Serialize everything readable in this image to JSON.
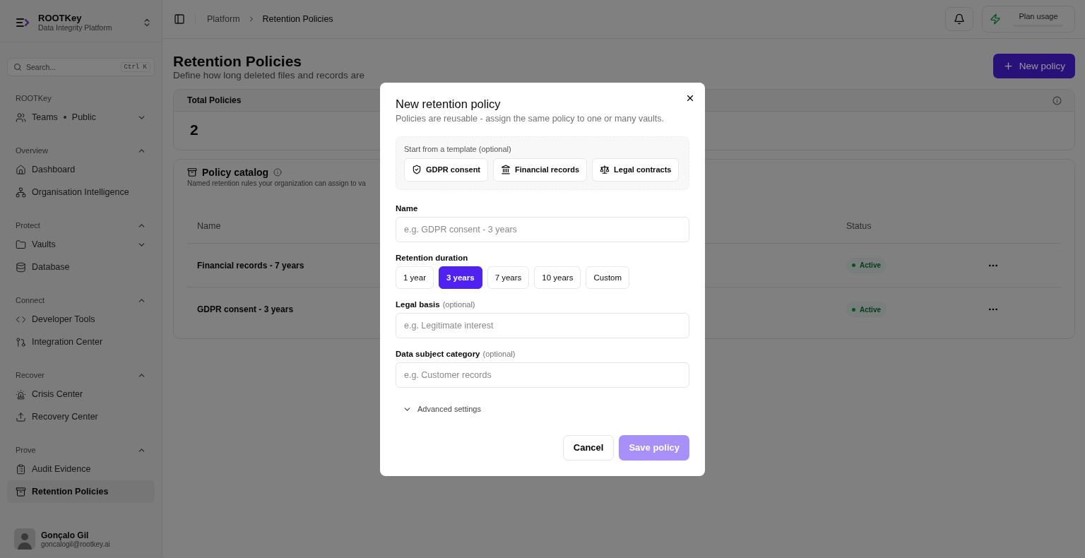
{
  "sidebar": {
    "org": {
      "name": "ROOTKey",
      "subtitle": "Data Integrity Platform"
    },
    "search": {
      "placeholder": "Search...",
      "shortcut": "Ctrl K"
    },
    "sections": [
      {
        "title": "ROOTKey",
        "items": [
          {
            "label": "Teams",
            "suffix": "Public",
            "expandable": true,
            "selected": false
          }
        ]
      },
      {
        "title": "Overview",
        "expanded": true,
        "items": [
          {
            "label": "Dashboard",
            "selected": false
          },
          {
            "label": "Organisation Intelligence",
            "selected": false
          }
        ]
      },
      {
        "title": "Protect",
        "expanded": true,
        "items": [
          {
            "label": "Vaults",
            "expandable": true,
            "selected": false
          },
          {
            "label": "Database",
            "selected": false
          }
        ]
      },
      {
        "title": "Connect",
        "expanded": true,
        "items": [
          {
            "label": "Developer Tools",
            "selected": false
          },
          {
            "label": "Integration Center",
            "selected": false
          }
        ]
      },
      {
        "title": "Recover",
        "expanded": true,
        "items": [
          {
            "label": "Crisis Center",
            "selected": false
          },
          {
            "label": "Recovery Center",
            "selected": false
          }
        ]
      },
      {
        "title": "Prove",
        "expanded": true,
        "items": [
          {
            "label": "Audit Evidence",
            "selected": false
          },
          {
            "label": "Retention Policies",
            "selected": true
          }
        ]
      }
    ],
    "user": {
      "name": "Gonçalo Gil",
      "email": "goncalogil@rootkey.ai"
    }
  },
  "header": {
    "breadcrumbs": [
      "Platform",
      "Retention Policies"
    ],
    "plan_button": "Plan usage"
  },
  "page": {
    "title": "Retention Policies",
    "subtitle": "Define how long deleted files and records are",
    "new_button": "New policy",
    "stat": {
      "label": "Total Policies",
      "value": "2"
    },
    "catalog": {
      "title": "Policy catalog",
      "subtitle": "Named retention rules your organization can assign to va",
      "columns": [
        "Name",
        "Status"
      ],
      "rows": [
        {
          "name": "Financial records - 7 years",
          "status": "Active",
          "color": "#0b5125"
        },
        {
          "name": "GDPR consent - 3 years",
          "status": "Active",
          "color": "#0b5125"
        }
      ]
    }
  },
  "modal": {
    "title": "New retention policy",
    "description": "Policies are reusable - assign the same policy to one or many vaults.",
    "template_label": "Start from a template (optional)",
    "templates": [
      "GDPR consent",
      "Financial records",
      "Legal contracts"
    ],
    "name_label": "Name",
    "name_placeholder": "e.g. GDPR consent - 3 years",
    "duration_label": "Retention duration",
    "durations": [
      {
        "label": "1 year",
        "selected": false
      },
      {
        "label": "3 years",
        "selected": true
      },
      {
        "label": "7 years",
        "selected": false
      },
      {
        "label": "10 years",
        "selected": false
      },
      {
        "label": "Custom",
        "selected": false
      }
    ],
    "legal_label": "Legal basis",
    "legal_hint": "(optional)",
    "legal_placeholder": "e.g. Legitimate interest",
    "subject_label": "Data subject category",
    "subject_hint": "(optional)",
    "subject_placeholder": "e.g. Customer records",
    "advanced": {
      "label": "Advanced settings",
      "expanded": false
    },
    "cancel": "Cancel",
    "save": {
      "label": "Save policy",
      "disabled": true
    }
  }
}
